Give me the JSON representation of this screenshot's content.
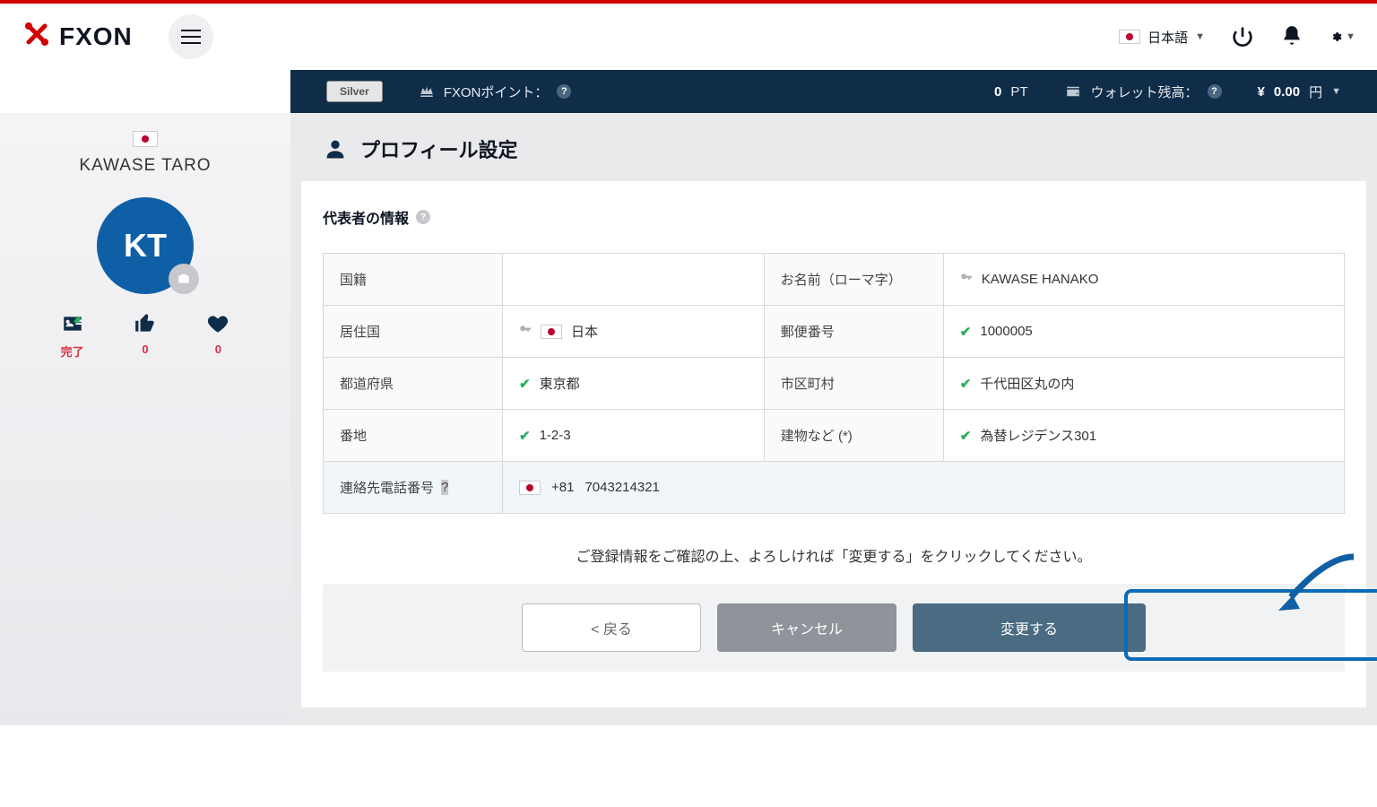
{
  "header": {
    "logo_text": "FXON",
    "language": "日本語",
    "power_icon": "power-icon",
    "bell_icon": "bell-icon",
    "gear_icon": "gear-icon"
  },
  "info_bar": {
    "badge": "Silver",
    "points_label": "FXONポイント：",
    "points_value": "0",
    "points_unit": "PT",
    "wallet_label": "ウォレット残高：",
    "wallet_symbol": "¥",
    "wallet_value": "0.00",
    "wallet_currency": "円"
  },
  "sidebar": {
    "user_name": "KAWASE TARO",
    "avatar_initials": "KT",
    "stats": {
      "status_label": "完了",
      "likes": "0",
      "favorites": "0"
    }
  },
  "page": {
    "title": "プロフィール設定",
    "section_label": "代表者の情報"
  },
  "table": {
    "rows": [
      {
        "label1": "国籍",
        "value1": "",
        "label2": "お名前（ローマ字）",
        "value2": "KAWASE HANAKO",
        "icon1": "",
        "icon2": "key"
      },
      {
        "label1": "居住国",
        "value1": "日本",
        "label2": "郵便番号",
        "value2": "1000005",
        "icon1": "key-flag",
        "icon2": "check"
      },
      {
        "label1": "都道府県",
        "value1": "東京都",
        "label2": "市区町村",
        "value2": "千代田区丸の内",
        "icon1": "check",
        "icon2": "check"
      },
      {
        "label1": "番地",
        "value1": "1-2-3",
        "label2": "建物など (*)",
        "value2": "為替レジデンス301",
        "icon1": "check",
        "icon2": "check"
      },
      {
        "label1": "連絡先電話番号",
        "value1_pre": "+81",
        "value1": "7043214321",
        "label2": "",
        "value2": "",
        "icon1": "flag",
        "phone": true
      }
    ]
  },
  "instruction": "ご登録情報をご確認の上、よろしければ「変更する」をクリックしてください。",
  "buttons": {
    "back": "< 戻る",
    "cancel": "キャンセル",
    "submit": "変更する"
  }
}
